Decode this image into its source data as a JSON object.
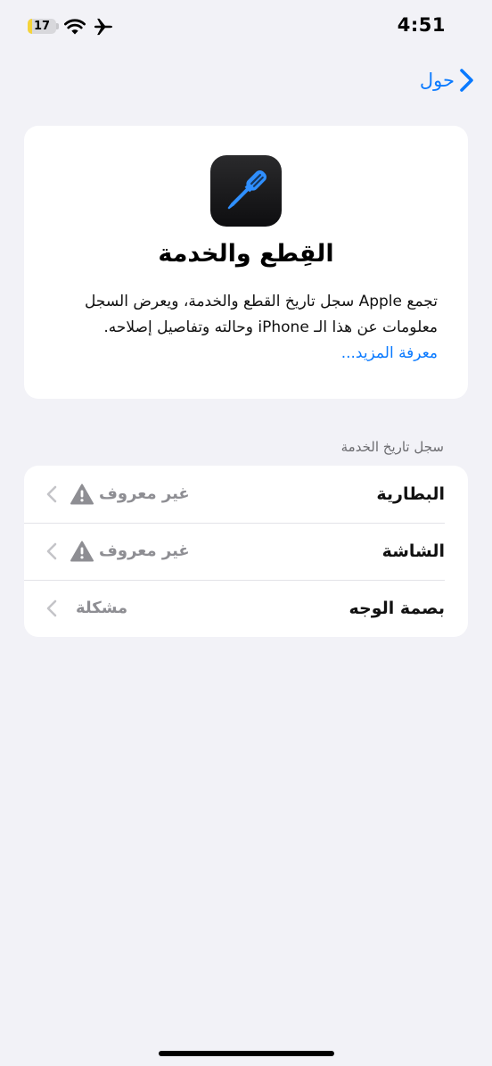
{
  "status_bar": {
    "time": "4:51",
    "battery_level": "17",
    "battery_fraction": 0.17
  },
  "nav": {
    "back_label": "حول"
  },
  "hero": {
    "title": "القِطع والخدمة",
    "description": "تجمع Apple سجل تاريخ القطع والخدمة، ويعرض السجل معلومات عن هذا الـ iPhone وحالته وتفاصيل إصلاحه.",
    "learn_more": "معرفة المزيد..."
  },
  "section": {
    "header": "سجل تاريخ الخدمة"
  },
  "rows": [
    {
      "label": "البطارية",
      "value": "غير معروف",
      "warning": true
    },
    {
      "label": "الشاشة",
      "value": "غير معروف",
      "warning": true
    },
    {
      "label": "بصمة الوجه",
      "value": "مشكلة",
      "warning": false
    }
  ],
  "colors": {
    "accent": "#0a7aff",
    "background": "#f2f2f7",
    "secondary_text": "#8e8e93"
  },
  "icons": [
    "battery-icon",
    "wifi-icon",
    "airplane-icon",
    "chevron-right-icon",
    "screwdriver-icon",
    "warning-icon",
    "chevron-left-icon"
  ]
}
